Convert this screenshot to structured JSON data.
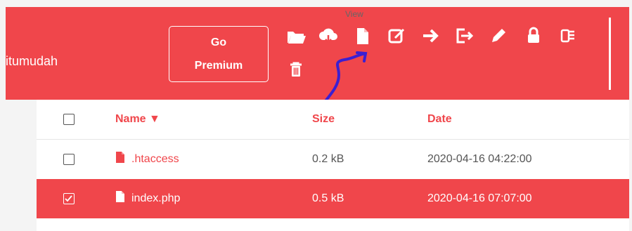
{
  "header": {
    "brand": "itumudah",
    "premium_line1": "Go",
    "premium_line2": "Premium",
    "tooltip": "View",
    "toolbar": [
      {
        "icon": "folder-open-icon"
      },
      {
        "icon": "cloud-download-icon"
      },
      {
        "icon": "file-icon"
      },
      {
        "icon": "edit-icon"
      },
      {
        "icon": "arrow-right-icon"
      },
      {
        "icon": "sign-out-icon"
      },
      {
        "icon": "pencil-icon"
      },
      {
        "icon": "lock-icon"
      },
      {
        "icon": "archive-icon"
      },
      {
        "icon": "trash-icon"
      }
    ]
  },
  "table": {
    "columns": {
      "name": "Name ▼",
      "size": "Size",
      "date": "Date"
    },
    "rows": [
      {
        "name": ".htaccess",
        "size": "0.2 kB",
        "date": "2020-04-16 04:22:00",
        "checked": false
      },
      {
        "name": "index.php",
        "size": "0.5 kB",
        "date": "2020-04-16 07:07:00",
        "checked": true
      }
    ]
  },
  "colors": {
    "accent": "#f0464b",
    "annotation": "#3b1fd1"
  }
}
